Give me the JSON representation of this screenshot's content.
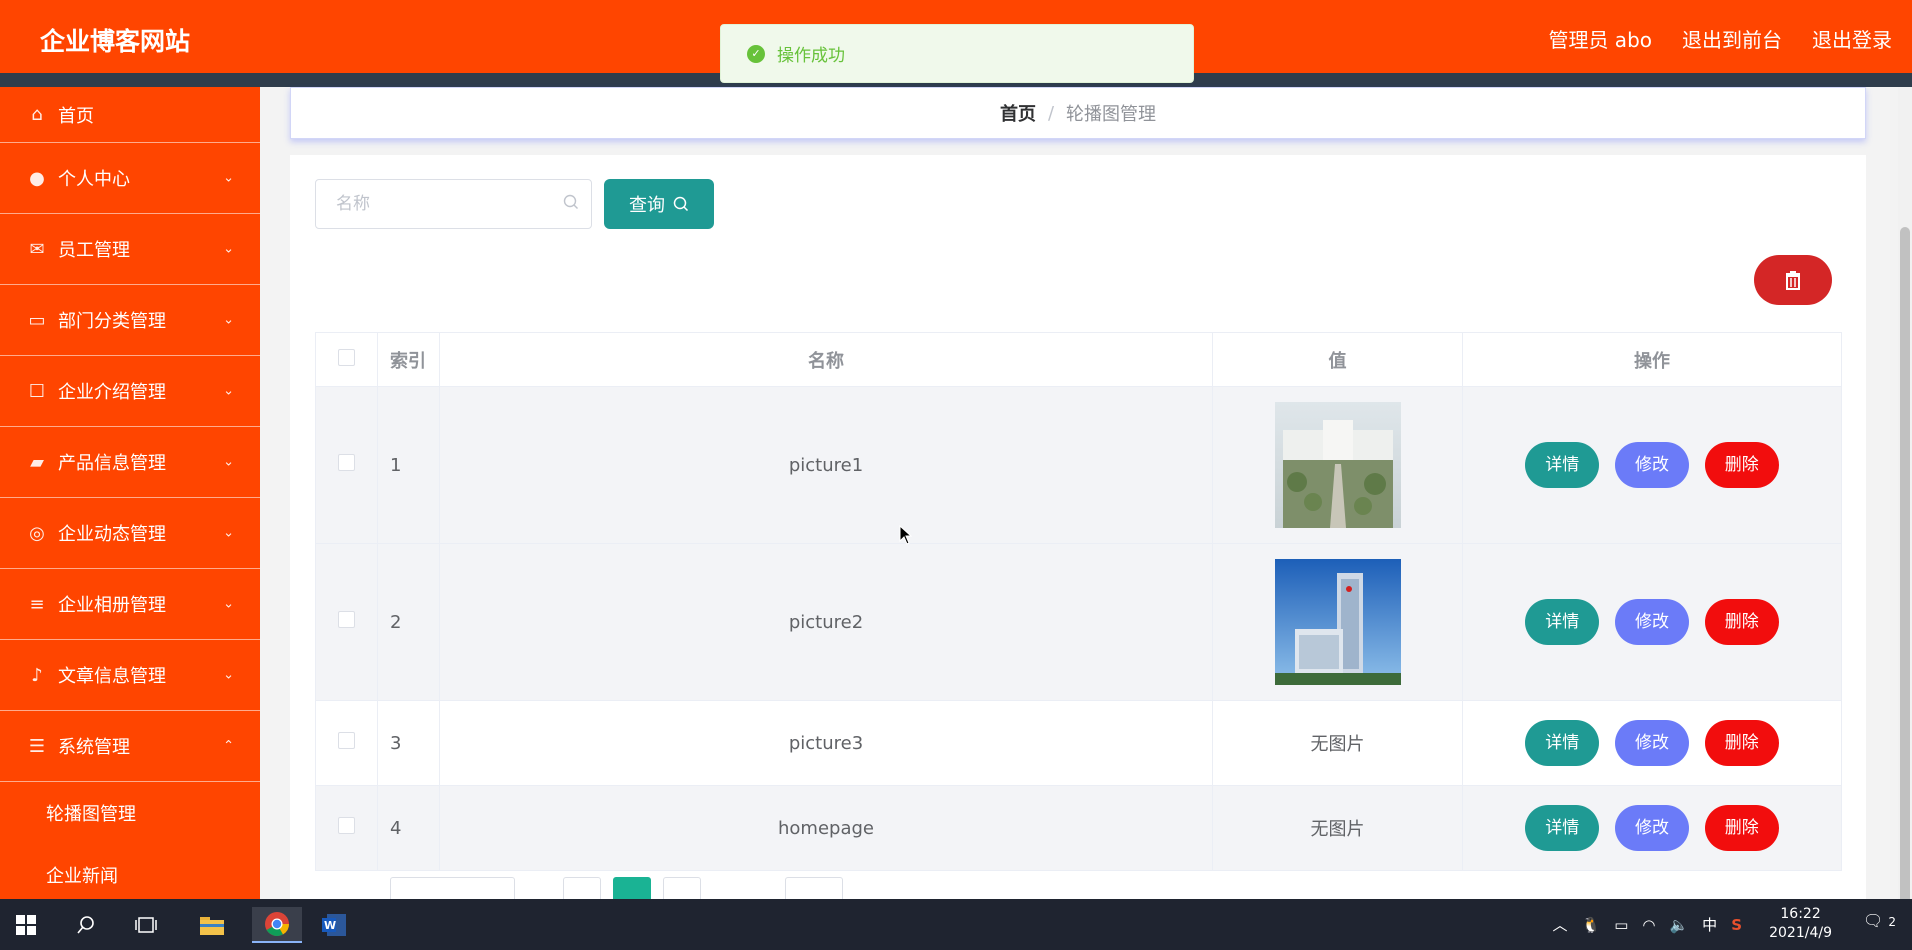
{
  "header": {
    "brand": "企业博客网站",
    "user": "管理员 abo",
    "to_front": "退出到前台",
    "logout": "退出登录"
  },
  "toast": {
    "message": "操作成功"
  },
  "sidebar": {
    "items": [
      {
        "label": "首页",
        "icon": "home-icon"
      },
      {
        "label": "个人中心",
        "icon": "user-icon"
      },
      {
        "label": "员工管理",
        "icon": "mail-icon"
      },
      {
        "label": "部门分类管理",
        "icon": "tag-icon"
      },
      {
        "label": "企业介绍管理",
        "icon": "chat-icon"
      },
      {
        "label": "产品信息管理",
        "icon": "wallet-icon"
      },
      {
        "label": "企业动态管理",
        "icon": "circle-icon"
      },
      {
        "label": "企业相册管理",
        "icon": "list-icon"
      },
      {
        "label": "文章信息管理",
        "icon": "bell-off-icon"
      },
      {
        "label": "系统管理",
        "icon": "menu-icon"
      }
    ],
    "sub_items": [
      "轮播图管理",
      "企业新闻"
    ]
  },
  "breadcrumb": {
    "home": "首页",
    "separator": "/",
    "current": "轮播图管理"
  },
  "search": {
    "placeholder": "名称",
    "button": "查询"
  },
  "table": {
    "headers": {
      "index": "索引",
      "name": "名称",
      "value": "值",
      "actions": "操作"
    },
    "rows": [
      {
        "index": "1",
        "name": "picture1",
        "value": "",
        "has_image": true
      },
      {
        "index": "2",
        "name": "picture2",
        "value": "",
        "has_image": true
      },
      {
        "index": "3",
        "name": "picture3",
        "value": "无图片",
        "has_image": false
      },
      {
        "index": "4",
        "name": "homepage",
        "value": "无图片",
        "has_image": false
      }
    ],
    "actions": {
      "detail": "详情",
      "edit": "修改",
      "delete": "删除"
    }
  },
  "taskbar": {
    "time": "16:22",
    "date": "2021/4/9",
    "ime": "中",
    "notifications": "2"
  },
  "colors": {
    "header": "#ff4500",
    "teal": "#1f9a94",
    "purple": "#6b7bf8",
    "red": "#f20d0d"
  }
}
